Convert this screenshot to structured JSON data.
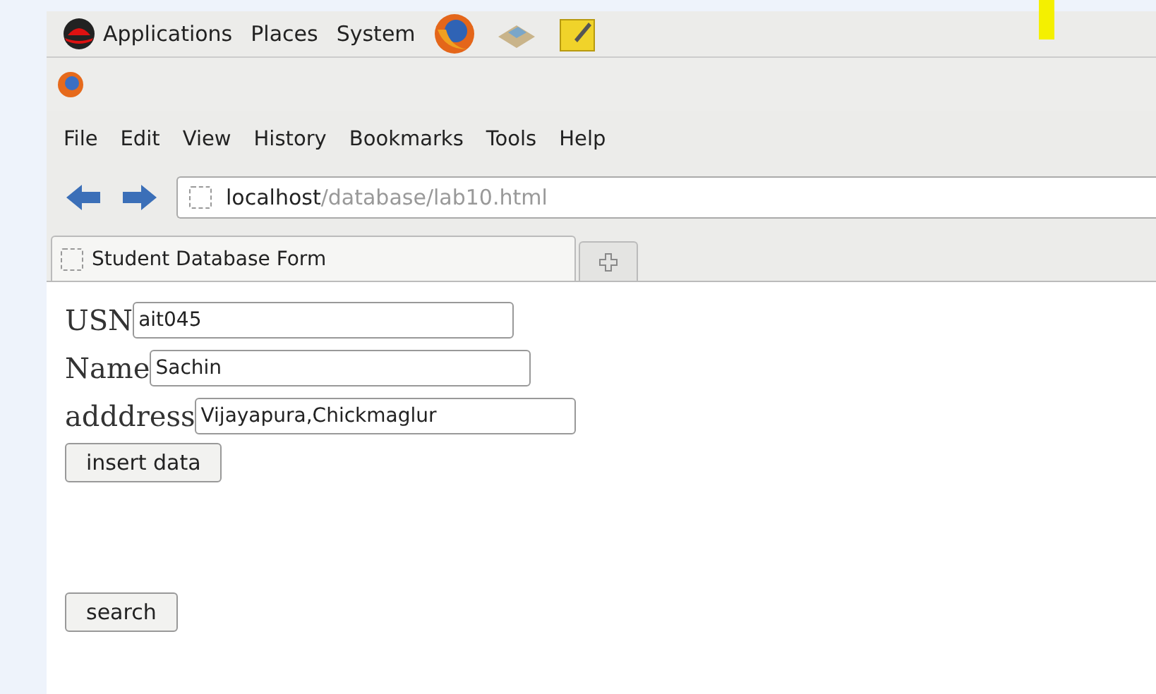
{
  "panel": {
    "menus": [
      "Applications",
      "Places",
      "System"
    ]
  },
  "menu_bar": {
    "items": [
      "File",
      "Edit",
      "View",
      "History",
      "Bookmarks",
      "Tools",
      "Help"
    ]
  },
  "address_bar": {
    "host": "localhost",
    "path": "/database/lab10.html"
  },
  "tabs": [
    {
      "label": "Student Database Form",
      "selected": true
    }
  ],
  "form": {
    "fields": [
      {
        "label": "USN",
        "value": "ait045"
      },
      {
        "label": "Name",
        "value": "Sachin"
      },
      {
        "label": "adddress",
        "value": "Vijayapura,Chickmaglur"
      }
    ],
    "insert_button": "insert data",
    "search_button": "search"
  }
}
